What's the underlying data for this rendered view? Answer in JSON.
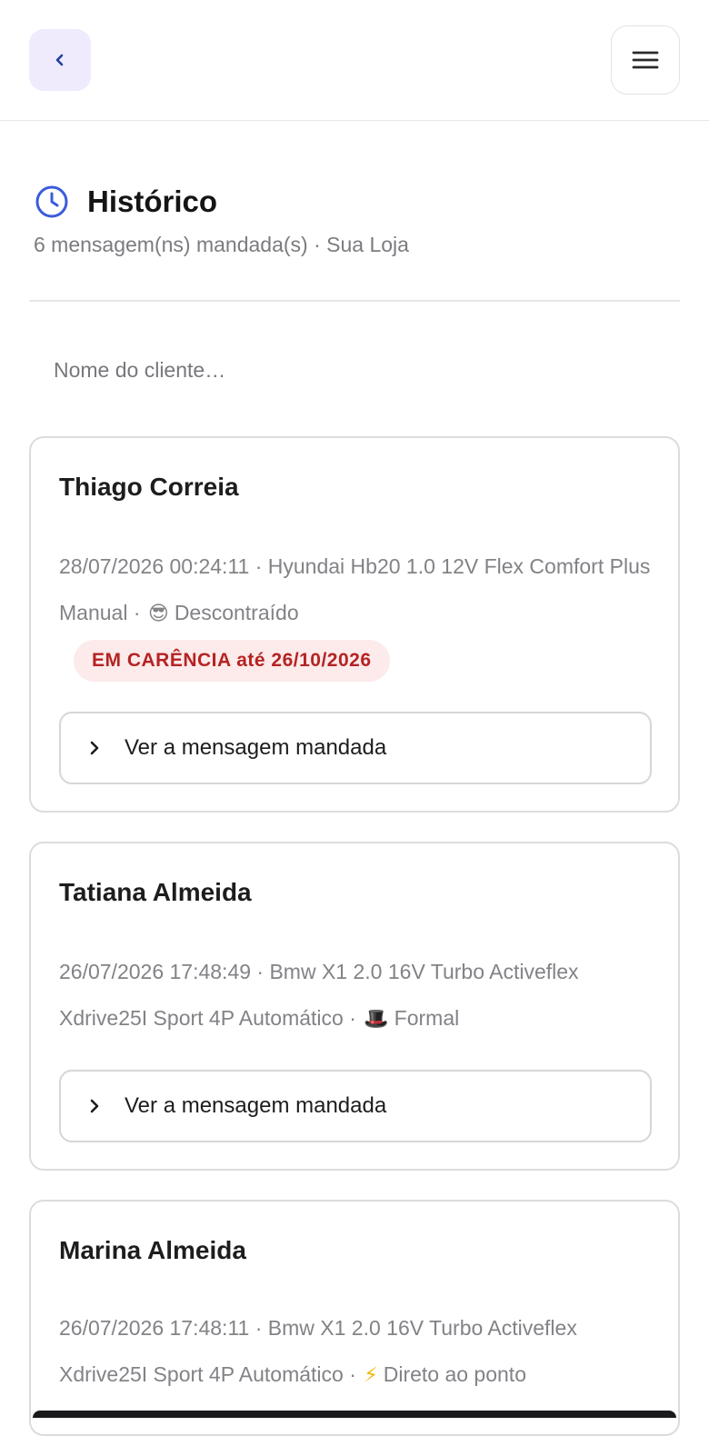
{
  "header": {
    "back_icon": "chevron-left-icon",
    "menu_icon": "hamburger-menu-icon"
  },
  "page": {
    "title": "Histórico",
    "title_icon": "clock-icon",
    "subtitle": "6 mensagem(ns) mandada(s) · Sua Loja"
  },
  "search": {
    "placeholder": "Nome do cliente…",
    "value": ""
  },
  "cards": [
    {
      "name": "Thiago Correia",
      "meta": "28/07/2026 00:24:11 · Hyundai Hb20 1.0 12V Flex Comfort Plus Manual · ",
      "emoji": "😎",
      "tone": "Descontraído",
      "badge": "EM CARÊNCIA até 26/10/2026",
      "action": "Ver a mensagem mandada"
    },
    {
      "name": "Tatiana Almeida",
      "meta": "26/07/2026 17:48:49 · Bmw X1 2.0 16V Turbo Activeflex Xdrive25I Sport 4P Automático · ",
      "emoji": "🎩",
      "tone": "Formal",
      "action": "Ver a mensagem mandada"
    },
    {
      "name": "Marina Almeida",
      "meta": "26/07/2026 17:48:11 · Bmw X1 2.0 16V Turbo Activeflex Xdrive25I Sport 4P Automático · ",
      "emoji": "⚡",
      "tone": "Direto ao ponto"
    }
  ],
  "colors": {
    "accent": "#3b5bdb",
    "back_button_bg": "#efeafc",
    "badge_bg": "#fdeaea",
    "badge_text": "#b42323"
  }
}
